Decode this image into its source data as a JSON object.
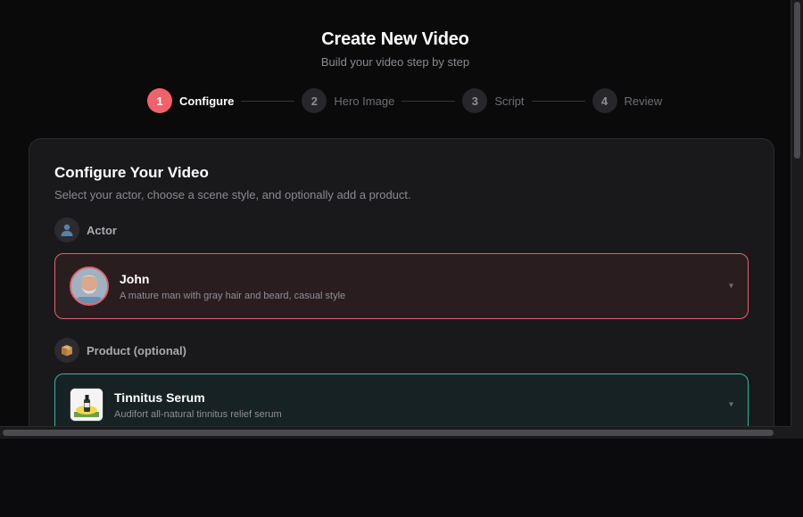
{
  "header": {
    "title": "Create New Video",
    "subtitle": "Build your video step by step"
  },
  "stepper": {
    "steps": [
      {
        "number": "1",
        "label": "Configure",
        "active": true
      },
      {
        "number": "2",
        "label": "Hero Image",
        "active": false
      },
      {
        "number": "3",
        "label": "Script",
        "active": false
      },
      {
        "number": "4",
        "label": "Review",
        "active": false
      }
    ]
  },
  "card": {
    "title": "Configure Your Video",
    "description": "Select your actor, choose a scene style, and optionally add a product."
  },
  "actor_section": {
    "icon": "person-icon",
    "label": "Actor",
    "selected_name": "John",
    "selected_description": "A mature man with gray hair and beard, casual style",
    "chevron": "▾"
  },
  "product_section": {
    "icon": "package-icon",
    "label": "Product (optional)",
    "selected_name": "Tinnitus Serum",
    "selected_description": "Audifort all-natural tinnitus relief serum",
    "chevron": "▾"
  },
  "colors": {
    "accent": "#f2616a",
    "actor_border": "#e0646c",
    "product_border": "#37b4a4"
  }
}
